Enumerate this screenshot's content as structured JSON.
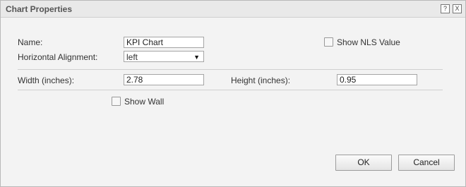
{
  "window": {
    "title": "Chart Properties",
    "help_label": "?",
    "close_label": "X"
  },
  "form": {
    "name_label": "Name:",
    "name_value": "KPI Chart",
    "show_nls_label": "Show NLS Value",
    "halign_label": "Horizontal Alignment:",
    "halign_value": "left",
    "width_label": "Width (inches):",
    "width_value": "2.78",
    "height_label": "Height (inches):",
    "height_value": "0.95",
    "show_wall_label": "Show Wall"
  },
  "buttons": {
    "ok": "OK",
    "cancel": "Cancel"
  }
}
